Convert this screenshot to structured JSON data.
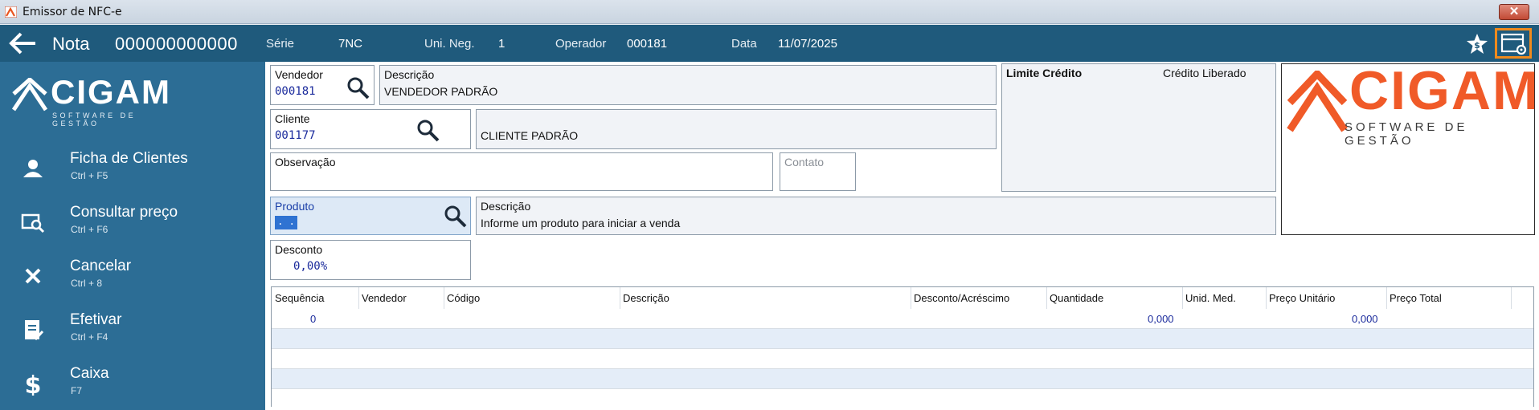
{
  "window": {
    "title": "Emissor de NFC-e",
    "close_glyph": "✕"
  },
  "header": {
    "title": "Nota",
    "number": "000000000000",
    "serie_label": "Série",
    "serie_value": "7NC",
    "unineg_label": "Uni. Neg.",
    "unineg_value": "1",
    "operador_label": "Operador",
    "operador_value": "000181",
    "data_label": "Data",
    "data_value": "11/07/2025"
  },
  "brand": {
    "name": "CIGAM",
    "tagline": "SOFTWARE DE GESTÃO",
    "accent": "#f05a28"
  },
  "sidebar": {
    "items": [
      {
        "label": "Ficha de Clientes",
        "shortcut": "Ctrl + F5",
        "icon": "user-icon"
      },
      {
        "label": "Consultar preço",
        "shortcut": "Ctrl + F6",
        "icon": "price-search-icon"
      },
      {
        "label": "Cancelar",
        "shortcut": "Ctrl + 8",
        "icon": "close-icon"
      },
      {
        "label": "Efetivar",
        "shortcut": "Ctrl + F4",
        "icon": "document-icon"
      },
      {
        "label": "Caixa",
        "shortcut": "F7",
        "icon": "dollar-icon"
      }
    ]
  },
  "form": {
    "vendedor": {
      "label": "Vendedor",
      "value": "000181"
    },
    "vendedor_desc": {
      "label": "Descrição",
      "value": "VENDEDOR PADRÃO"
    },
    "cliente": {
      "label": "Cliente",
      "value": "001177"
    },
    "cliente_desc": {
      "value": "CLIENTE PADRÃO"
    },
    "observacao": {
      "label": "Observação"
    },
    "contato": {
      "label": "Contato"
    },
    "produto": {
      "label": "Produto",
      "value": ". ."
    },
    "produto_desc": {
      "label": "Descrição",
      "value": "Informe um produto para iniciar a venda"
    },
    "desconto": {
      "label": "Desconto",
      "value": "0,00%"
    },
    "limite": {
      "label": "Limite Crédito",
      "status": "Crédito Liberado"
    }
  },
  "grid": {
    "columns": [
      "Sequência",
      "Vendedor",
      "Código",
      "Descrição",
      "Desconto/Acréscimo",
      "Quantidade",
      "Unid. Med.",
      "Preço Unitário",
      "Preço Total"
    ],
    "rows": [
      {
        "sequencia": "0",
        "quantidade": "0,000",
        "preco_unitario": "0,000"
      }
    ]
  },
  "colors": {
    "header": "#1f5a7c",
    "sidebar": "#2c6d95",
    "highlight": "#f08a1c",
    "selected_field": "#dde9f6"
  }
}
